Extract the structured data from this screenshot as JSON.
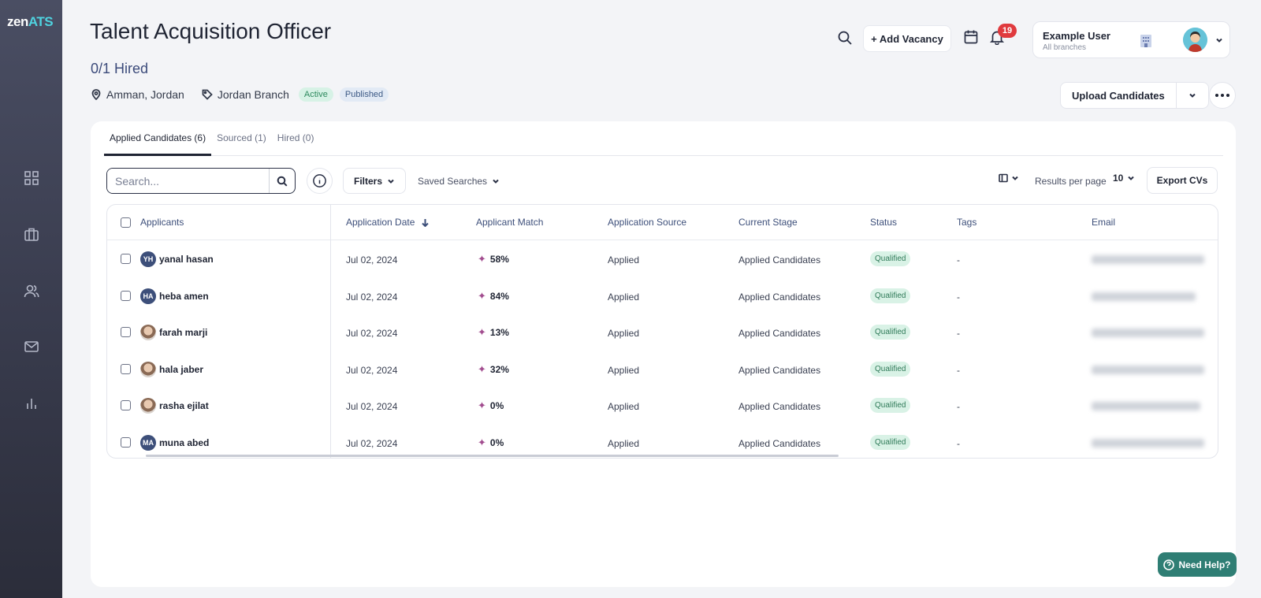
{
  "app": {
    "logo_part1": "zen",
    "logo_part2": "ATS"
  },
  "sidebar": {
    "items": [
      {
        "icon": "dashboard-grid-icon"
      },
      {
        "icon": "briefcase-icon"
      },
      {
        "icon": "users-icon"
      },
      {
        "icon": "mail-icon"
      },
      {
        "icon": "bar-chart-icon"
      }
    ]
  },
  "header": {
    "title": "Talent Acquisition Officer",
    "hired": "0/1 Hired",
    "location": "Amman, Jordan",
    "branch": "Jordan Branch",
    "status_badge": "Active",
    "publish_badge": "Published",
    "add_vacancy": "+ Add Vacancy",
    "notification_count": "19",
    "user_name": "Example User",
    "user_branch": "All branches",
    "upload_candidates": "Upload Candidates"
  },
  "tabs": [
    {
      "label": "Applied Candidates (6)",
      "active": true
    },
    {
      "label": "Sourced (1)",
      "active": false
    },
    {
      "label": "Hired (0)",
      "active": false
    }
  ],
  "toolbar": {
    "search_placeholder": "Search...",
    "filters": "Filters",
    "saved_searches": "Saved Searches",
    "results_per_page_label": "Results per page",
    "results_per_page_value": "10",
    "export_cvs": "Export CVs"
  },
  "table": {
    "columns": [
      "Applicants",
      "Application Date",
      "Applicant Match",
      "Application Source",
      "Current Stage",
      "Status",
      "Tags",
      "Email"
    ],
    "rows": [
      {
        "initials": "YH",
        "avatar": "initials",
        "name": "yanal hasan",
        "date": "Jul 02, 2024",
        "match": "58%",
        "source": "Applied",
        "stage": "Applied Candidates",
        "status": "Qualified",
        "tags": "-"
      },
      {
        "initials": "HA",
        "avatar": "initials",
        "name": "heba amen",
        "date": "Jul 02, 2024",
        "match": "84%",
        "source": "Applied",
        "stage": "Applied Candidates",
        "status": "Qualified",
        "tags": "-"
      },
      {
        "initials": "",
        "avatar": "photo",
        "name": "farah marji",
        "date": "Jul 02, 2024",
        "match": "13%",
        "source": "Applied",
        "stage": "Applied Candidates",
        "status": "Qualified",
        "tags": "-"
      },
      {
        "initials": "",
        "avatar": "photo",
        "name": "hala jaber",
        "date": "Jul 02, 2024",
        "match": "32%",
        "source": "Applied",
        "stage": "Applied Candidates",
        "status": "Qualified",
        "tags": "-"
      },
      {
        "initials": "",
        "avatar": "photo",
        "name": "rasha ejilat",
        "date": "Jul 02, 2024",
        "match": "0%",
        "source": "Applied",
        "stage": "Applied Candidates",
        "status": "Qualified",
        "tags": "-"
      },
      {
        "initials": "MA",
        "avatar": "initials",
        "name": "muna abed",
        "date": "Jul 02, 2024",
        "match": "0%",
        "source": "Applied",
        "stage": "Applied Candidates",
        "status": "Qualified",
        "tags": "-"
      }
    ]
  },
  "help": {
    "label": "Need Help?"
  },
  "colors": {
    "sidebar": "#3a3d4f",
    "accent_logo": "#4fd3e0",
    "badge_red": "#e03a3e",
    "help_green": "#2f7e74",
    "match_star": "#a24d8f"
  }
}
